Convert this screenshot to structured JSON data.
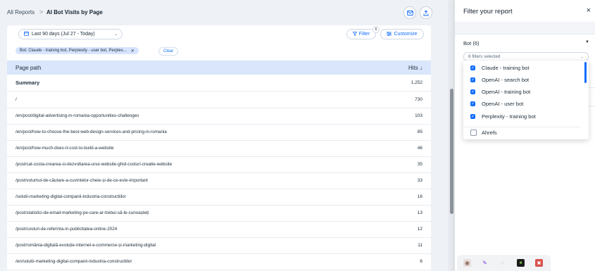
{
  "breadcrumb": {
    "root": "All Reports",
    "separator": ">",
    "current": "AI Bot Visits by Page"
  },
  "toolbar": {
    "date_range": "Last 90 days (Jul 27 - Today)",
    "filter_label": "Filter",
    "filter_count": "6",
    "customize_label": "Customize"
  },
  "active_filter": {
    "chip_label": "Bot: Claude - training bot, Perplexity - user bot, Perplex...",
    "clear_label": "Clear"
  },
  "table": {
    "col_path": "Page path",
    "col_hits": "Hits ↓",
    "summary": {
      "path": "Summary",
      "hits": "1,252"
    },
    "rows": [
      {
        "path": "/",
        "hits": "730"
      },
      {
        "path": "/en/post/digital-advertising-in-romania-opportunities-challenges",
        "hits": "103"
      },
      {
        "path": "/en/post/how-to-choose-the-best-web-design-services-and-pricing-in-romania",
        "hits": "85"
      },
      {
        "path": "/en/post/how-much-does-it-cost-to-build-a-website",
        "hits": "46"
      },
      {
        "path": "/post/cat-costa-crearea-si-dezvoltarea-unui-website-ghid-costuri-creatie-website",
        "hits": "35"
      },
      {
        "path": "/post/volumul-de-căutare-a-cuvintelor-cheie-și-de-ce-este-important",
        "hits": "33"
      },
      {
        "path": "/solutii-marketing-digital-companii-industria-constructiilor",
        "hits": "16"
      },
      {
        "path": "/post/statistici-de-email-marketing-pe-care-ar-trebui-să-le-cunoaștеți",
        "hits": "13"
      },
      {
        "path": "/post/costuri-de-referinta-in-publicitatea-online-2024",
        "hits": "12"
      },
      {
        "path": "/post/românia-digitală-evoluție-internet-e-commerce-și-marketing-digital",
        "hits": "11"
      },
      {
        "path": "/en/solutii-marketing-digital-companii-industria-constructiilor",
        "hits": "6"
      }
    ]
  },
  "panel": {
    "title": "Filter your report",
    "close": "×",
    "bot_label": "Bot (6)",
    "multiselect_text": "6 filters selected",
    "options": [
      {
        "label": "Claude - training bot",
        "checked": true
      },
      {
        "label": "OpenAI - search bot",
        "checked": true
      },
      {
        "label": "OpenAI - training bot",
        "checked": true
      },
      {
        "label": "OpenAI - user bot",
        "checked": true
      },
      {
        "label": "Perplexity - training bot",
        "checked": true
      },
      {
        "label": "Ahrefs",
        "checked": false
      }
    ]
  },
  "icons": {
    "mail": "mail-icon",
    "share": "share-icon",
    "calendar": "calendar-icon",
    "filter": "filter-icon",
    "customize": "customize-icon"
  },
  "colors": {
    "accent": "#116dff",
    "table_header": "#d9e6fb",
    "chip": "#d6e4ff"
  }
}
